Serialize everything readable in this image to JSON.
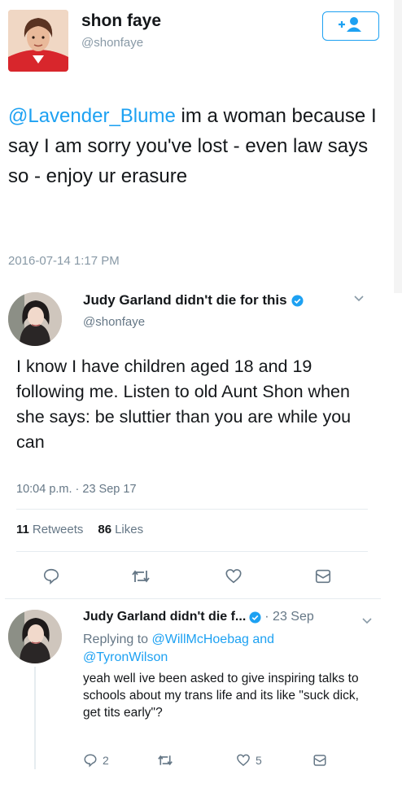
{
  "tweet1": {
    "name": "shon faye",
    "handle": "@shonfaye",
    "mention": "@Lavender_Blume",
    "text": " im a woman because I say I am sorry you've lost - even law says so - enjoy ur erasure",
    "timestamp": "2016-07-14 1:17 PM",
    "follow_icon": "add-user-icon"
  },
  "tweet2": {
    "name": "Judy Garland didn't die for this",
    "handle": "@shonfaye",
    "text": "I know I have children aged 18 and 19 following me. Listen to old Aunt Shon when she says: be sluttier than you are while you can",
    "timestamp": "10:04 p.m. · 23 Sep 17",
    "retweets_count": "11",
    "retweets_label": "Retweets",
    "likes_count": "86",
    "likes_label": "Likes"
  },
  "tweet3": {
    "name": "Judy Garland didn't die f...",
    "date": "· 23 Sep",
    "replying_prefix": "Replying to",
    "reply_to_1": "@WillMcHoebag",
    "reply_and": "and",
    "reply_to_2": "@TyronWilson",
    "text": "yeah well ive been asked to give inspiring talks to schools about my trans life and its like \"suck dick, get tits early\"?",
    "reply_count": "2",
    "retweet_count": "",
    "like_count": "5"
  },
  "colors": {
    "accent": "#1da1f2",
    "muted": "#657786",
    "text": "#14171a",
    "divider": "#e6ecf0"
  }
}
